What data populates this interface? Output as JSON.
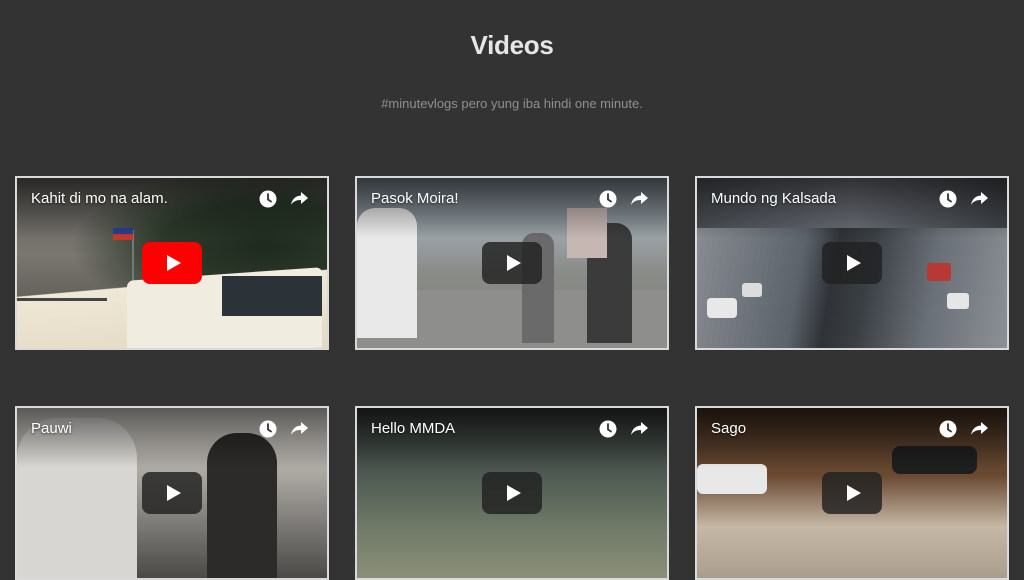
{
  "page": {
    "title": "Videos",
    "subtitle": "#minutevlogs pero yung iba hindi one minute."
  },
  "videos": [
    {
      "title": "Kahit di mo na alam.",
      "player": "youtube"
    },
    {
      "title": "Pasok Moira!",
      "player": "default"
    },
    {
      "title": "Mundo ng Kalsada",
      "player": "default"
    },
    {
      "title": "Pauwi",
      "player": "default"
    },
    {
      "title": "Hello MMDA",
      "player": "default"
    },
    {
      "title": "Sago",
      "player": "default"
    }
  ],
  "icons": {
    "watch_later": "clock-icon",
    "share": "share-icon",
    "play": "play-icon"
  },
  "colors": {
    "background": "#333333",
    "youtube_red": "#ff0000"
  }
}
